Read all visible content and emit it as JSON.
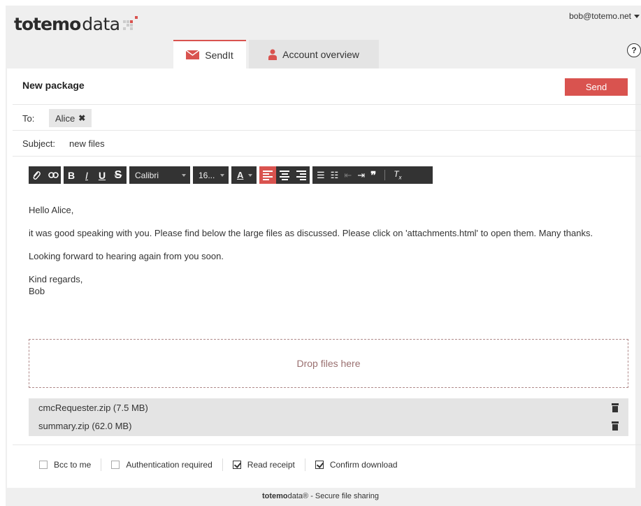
{
  "header": {
    "logo_bold": "totemo",
    "logo_light": "data",
    "user_email": "bob@totemo.net",
    "help_label": "?"
  },
  "tabs": [
    {
      "label": "SendIt",
      "active": true,
      "icon": "envelope-icon"
    },
    {
      "label": "Account overview",
      "active": false,
      "icon": "person-icon"
    }
  ],
  "package": {
    "title": "New package",
    "send_label": "Send",
    "to_label": "To:",
    "recipients": [
      {
        "name": "Alice"
      }
    ],
    "subject_label": "Subject:",
    "subject_value": "new files"
  },
  "toolbar": {
    "font": "Calibri",
    "size": "16...",
    "font_color_label": "A"
  },
  "message": {
    "paragraphs": [
      "Hello Alice,",
      "it was good speaking with you. Please find below the large files as discussed. Please click on 'attachments.html' to open them. Many thanks.",
      "Looking forward to hearing again from you soon."
    ],
    "closing_line1": "Kind regards,",
    "closing_line2": "Bob"
  },
  "drop_zone": {
    "label": "Drop files here"
  },
  "files": [
    {
      "label": "cmcRequester.zip (7.5 MB)"
    },
    {
      "label": "summary.zip (62.0 MB)"
    }
  ],
  "options": [
    {
      "label": "Bcc to me",
      "checked": false
    },
    {
      "label": "Authentication required",
      "checked": false
    },
    {
      "label": "Read receipt",
      "checked": true
    },
    {
      "label": "Confirm download",
      "checked": true
    }
  ],
  "footer": {
    "brand_bold": "totemo",
    "brand_light": "data®",
    "tagline": " - Secure file sharing"
  },
  "colors": {
    "accent": "#d9534f",
    "toolbar": "#333333",
    "background": "#efefef"
  }
}
